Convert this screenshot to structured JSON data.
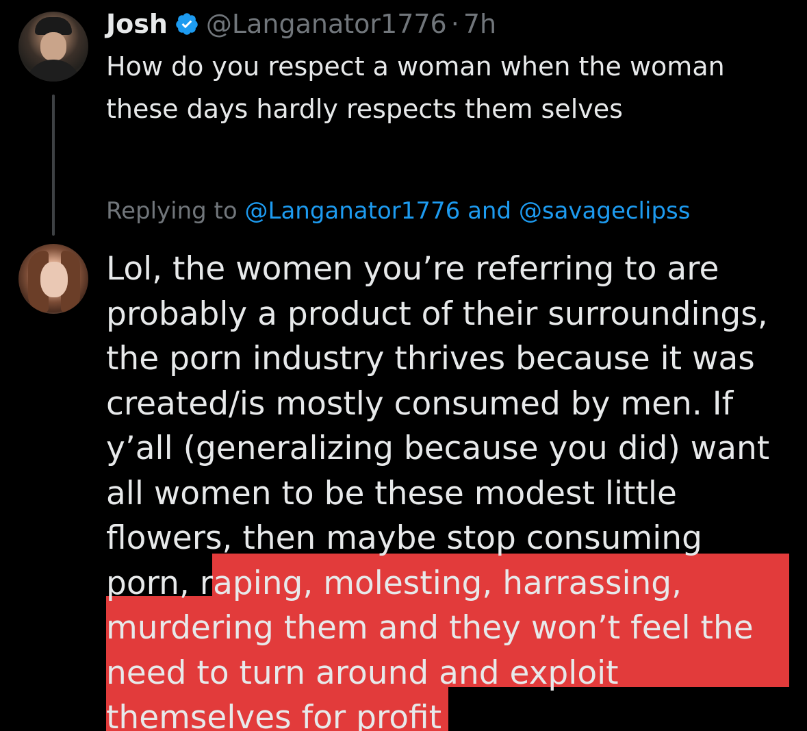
{
  "parent_tweet": {
    "display_name": "Josh",
    "handle": "@Langanator1776",
    "separator": "·",
    "time": "7h",
    "text_lines": [
      "How do you respect a woman when the woman",
      "these days hardly respects them selves"
    ]
  },
  "replying_to": {
    "prefix": "Replying to",
    "user1": "@Langanator1776",
    "conjunction": "and",
    "user2": "@savageclipss"
  },
  "reply": {
    "lines": [
      "Lol, the women you’re referring to are",
      "probably a product of their surroundings,",
      "the porn industry thrives because it was",
      "created/is mostly consumed by men. If",
      "y’all (generalizing because you did) want",
      "all women to be these modest little",
      "flowers, then maybe stop consuming",
      "porn, raping, molesting, harrassing,",
      "murdering them and they won’t feel the",
      "need to turn around and exploit",
      "themselves for profit"
    ]
  },
  "colors": {
    "background": "#000000",
    "text": "#e7e9ea",
    "muted": "#71767b",
    "link": "#1d9bf0",
    "highlight": "#e23b3b"
  }
}
